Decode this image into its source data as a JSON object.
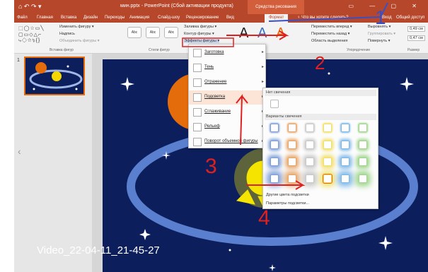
{
  "app": {
    "quick_access": "⌂ ↶ ↷ ▾",
    "doc_title": "мин.pptx - PowerPoint (Сбой активации продукта)",
    "context_tab_title": "Средства рисования",
    "window_buttons": "▭ — ▢ ✕"
  },
  "tabs": [
    "Файл",
    "Главная",
    "Вставка",
    "Дизайн",
    "Переходы",
    "Анимация",
    "Слайд-шоу",
    "Рецензирование",
    "Вид"
  ],
  "active_tab": "Формат",
  "tell_me": "♀ Что вы хотите сделать?",
  "account": {
    "login": "Вход",
    "share": "Общий доступ"
  },
  "ribbon": {
    "edit_shape": "Изменить фигуру ▾",
    "textbox": "Надпись",
    "merge_shapes": "Объединить фигуры ▾",
    "insert_shapes_label": "Вставка фигур",
    "shape_styles_label": "Стили фигур",
    "style_sample": "Abc",
    "shape_fill": "Заливка фигуры ▾",
    "shape_outline": "Контур фигуры ▾",
    "shape_effects": "Эффекты фигуры ▾",
    "bring_forward": "Переместить вперед ▾",
    "send_backward": "Переместить назад ▾",
    "selection_pane": "Область выделения",
    "align": "Выровнять ▾",
    "group": "Группировать ▾",
    "rotate": "Повернуть ▾",
    "arrange_label": "Упорядочение",
    "height": "0,49 см",
    "width": "0,47 см",
    "size_label": "Размер"
  },
  "thumbnail_number": "1",
  "effects_menu": [
    {
      "label": "Заготовка"
    },
    {
      "label": "Тень"
    },
    {
      "label": "Отражение"
    },
    {
      "label": "Подсветка"
    },
    {
      "label": "Сглаживание"
    },
    {
      "label": "Рельеф"
    },
    {
      "label": "Поворот объемной фигуры"
    }
  ],
  "glow_submenu": {
    "no_glow": "Нет свечения",
    "variants": "Варианты свечения",
    "other_colors": "Другие цвета подсветки",
    "glow_options": "Параметры подсветки..."
  },
  "annotations": {
    "n1": "1",
    "n2": "2",
    "n3": "3",
    "n4": "4"
  },
  "overlay_text": "Video_22-04-11_21-45-27",
  "colors": {
    "ribbon_brand": "#b7472a",
    "slide_bg": "#0c1f5c",
    "annotation_red": "#e02020",
    "annotation_blue": "#3a4fc4",
    "glow": "#f5e400"
  }
}
